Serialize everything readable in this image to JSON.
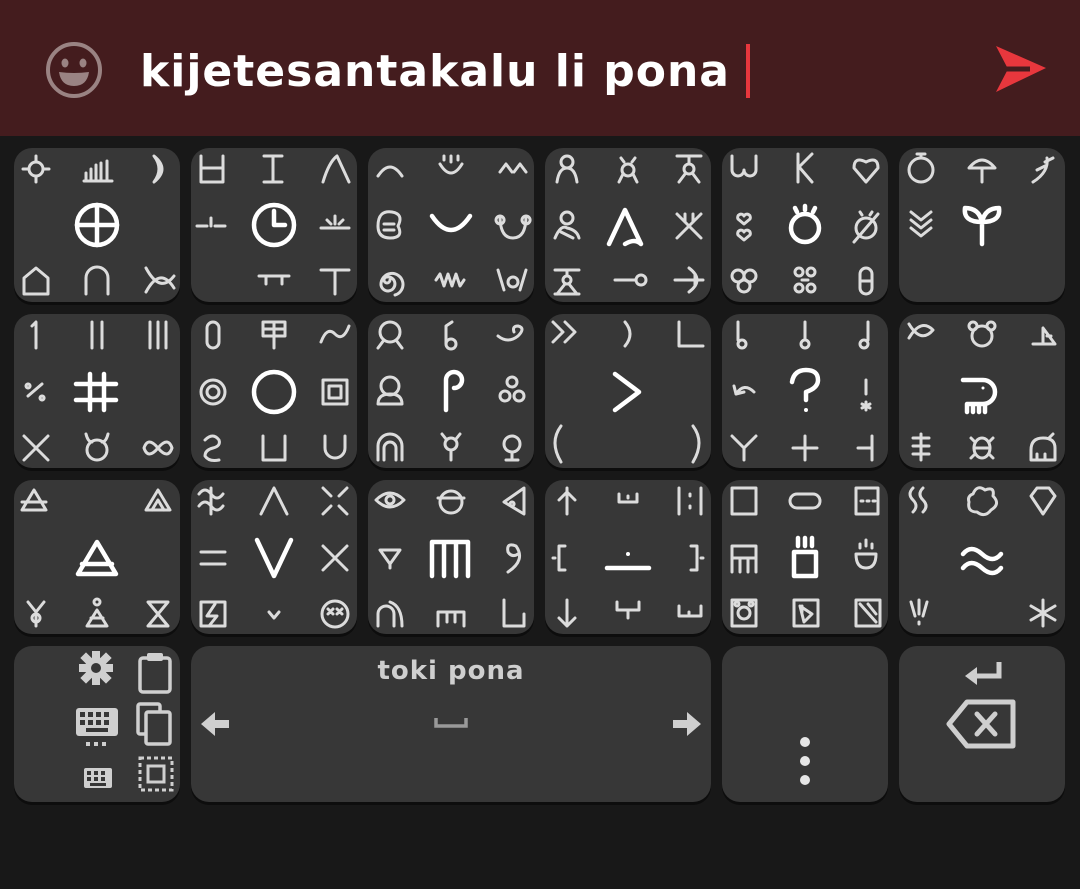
{
  "input": {
    "text": "kijetesantakalu li pona"
  },
  "space_key": {
    "label": "toki pona"
  },
  "colors": {
    "top_bar": "#441c1e",
    "key": "#373737",
    "background": "#181818",
    "accent": "#e8373d",
    "glyph": "#dcdcdc"
  },
  "icons": {
    "emoji": "smiley-face-icon",
    "send": "send-arrow-icon",
    "settings": "gear-icon",
    "clipboard": "clipboard-icon",
    "keyboard": "keyboard-icon",
    "copy": "copy-icon",
    "select_all": "select-all-icon",
    "left": "arrow-left-icon",
    "right": "arrow-right-icon",
    "space": "space-bar-icon",
    "more": "vertical-dots-icon",
    "enter": "enter-icon",
    "backspace": "backspace-icon"
  },
  "keys": [
    "key-1",
    "key-2",
    "key-3",
    "key-4",
    "key-5",
    "key-6",
    "key-7",
    "key-8",
    "key-9",
    "key-10",
    "key-11",
    "key-12",
    "key-13",
    "key-14",
    "key-15",
    "key-16",
    "key-17",
    "key-18"
  ]
}
